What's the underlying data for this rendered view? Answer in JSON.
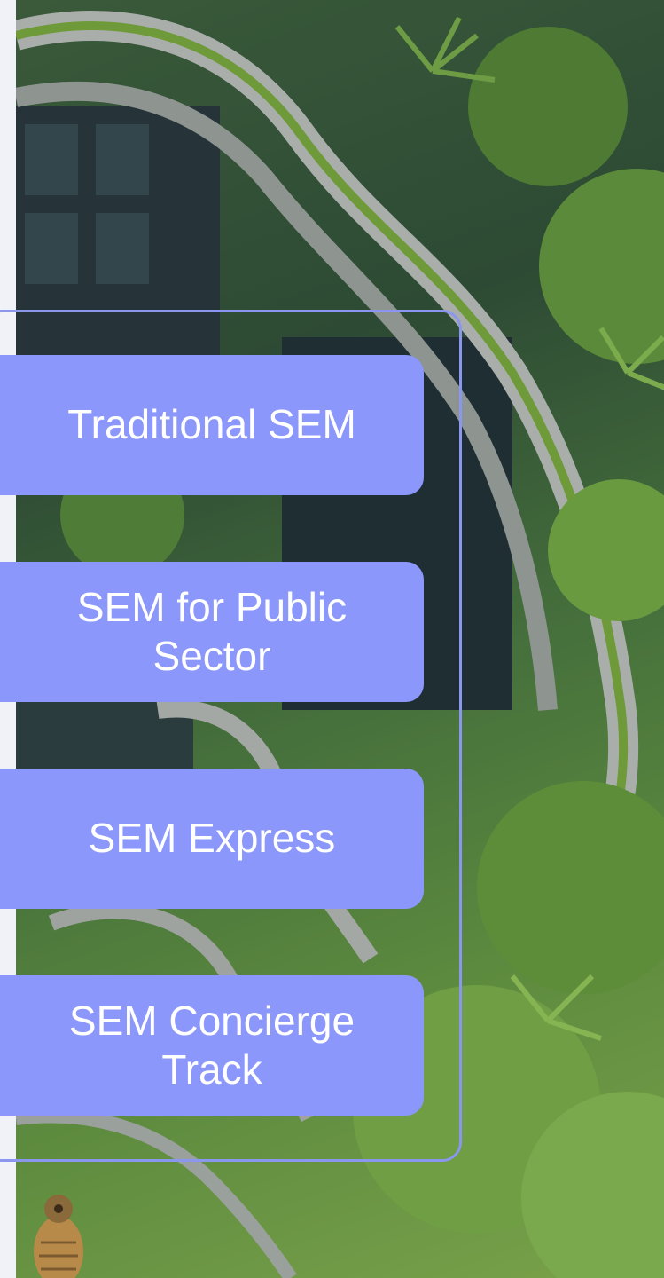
{
  "options": [
    {
      "label": "Traditional SEM"
    },
    {
      "label": "SEM for Public\nSector"
    },
    {
      "label": "SEM Express"
    },
    {
      "label": "SEM Concierge\nTrack"
    }
  ],
  "colors": {
    "option_background": "#8b97fb",
    "frame_border": "#8b97ee",
    "option_text": "#ffffff",
    "left_strip": "#f1f2f7"
  },
  "background": {
    "description_icon": "green-building-photo"
  }
}
